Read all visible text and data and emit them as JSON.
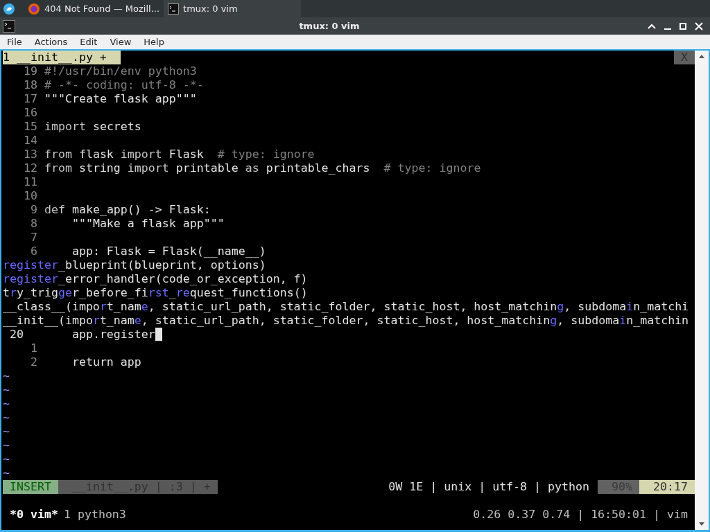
{
  "taskbar": {
    "tasks": [
      {
        "kind": "browser",
        "title": "404 Not Found — Mozill...",
        "selected": false
      },
      {
        "kind": "terminal",
        "title": "tmux: 0 vim",
        "selected": true
      }
    ]
  },
  "window": {
    "title": "tmux: 0 vim"
  },
  "menu": [
    "File",
    "Actions",
    "Edit",
    "View",
    "Help"
  ],
  "vim": {
    "tabs": [
      {
        "label": "1 __init__.py +",
        "selected": true
      }
    ],
    "close_label": "X",
    "lines": [
      {
        "kind": "code",
        "number": "19",
        "current": false,
        "cursor": false,
        "segments": [
          {
            "t": "#!/usr/bin/env python3",
            "kind": "comment"
          }
        ]
      },
      {
        "kind": "code",
        "number": "18",
        "current": false,
        "cursor": false,
        "segments": [
          {
            "t": "# -*- coding: utf-8 -*-",
            "kind": "comment"
          }
        ]
      },
      {
        "kind": "code",
        "number": "17",
        "current": false,
        "cursor": false,
        "segments": [
          {
            "t": "\"\"\"Create flask app\"\"\"",
            "kind": "plain"
          }
        ]
      },
      {
        "kind": "code",
        "number": "16",
        "current": false,
        "cursor": false
      },
      {
        "kind": "code",
        "number": "15",
        "current": false,
        "cursor": false,
        "segments": [
          {
            "t": "import",
            "kind": "keyword"
          },
          {
            "t": " secrets",
            "kind": "plain"
          }
        ]
      },
      {
        "kind": "code",
        "number": "14",
        "current": false,
        "cursor": false
      },
      {
        "kind": "code",
        "number": "13",
        "current": false,
        "cursor": false,
        "segments": [
          {
            "t": "from",
            "kind": "keyword"
          },
          {
            "t": " flask ",
            "kind": "plain"
          },
          {
            "t": "import",
            "kind": "keyword"
          },
          {
            "t": " Flask  ",
            "kind": "plain"
          },
          {
            "t": "# type: ignore",
            "kind": "comment"
          }
        ]
      },
      {
        "kind": "code",
        "number": "12",
        "current": false,
        "cursor": false,
        "segments": [
          {
            "t": "from",
            "kind": "keyword"
          },
          {
            "t": " string ",
            "kind": "plain"
          },
          {
            "t": "import",
            "kind": "keyword"
          },
          {
            "t": " printable ",
            "kind": "plain"
          },
          {
            "t": "as",
            "kind": "keyword"
          },
          {
            "t": " printable_chars  ",
            "kind": "plain"
          },
          {
            "t": "# type: ignore",
            "kind": "comment"
          }
        ]
      },
      {
        "kind": "code",
        "number": "11",
        "current": false,
        "cursor": false
      },
      {
        "kind": "code",
        "number": "10",
        "current": false,
        "cursor": false
      },
      {
        "kind": "code",
        "number": "9",
        "current": false,
        "cursor": false,
        "segments": [
          {
            "t": "def",
            "kind": "keyword"
          },
          {
            "t": " make_app() -> Flask:",
            "kind": "plain"
          }
        ]
      },
      {
        "kind": "code",
        "number": "8",
        "current": false,
        "cursor": false,
        "segments": [
          {
            "t": "    \"\"\"Make a flask app\"\"\"",
            "kind": "plain"
          }
        ]
      },
      {
        "kind": "code",
        "number": "7",
        "current": false,
        "cursor": false
      },
      {
        "kind": "code",
        "number": "6",
        "current": false,
        "cursor": false,
        "segments": [
          {
            "t": "    app: Flask = Flask(__name__)",
            "kind": "plain"
          }
        ]
      },
      {
        "kind": "completion",
        "segments": [
          {
            "t": "register",
            "kind": "match"
          },
          {
            "t": "_blueprint(blueprint, options)",
            "kind": "plain"
          }
        ]
      },
      {
        "kind": "completion",
        "segments": [
          {
            "t": "register",
            "kind": "match"
          },
          {
            "t": "_error_handler(code_or_exception, f)",
            "kind": "plain"
          }
        ]
      },
      {
        "kind": "completion",
        "segments": [
          {
            "t": "t",
            "kind": "plain"
          },
          {
            "t": "r",
            "kind": "match"
          },
          {
            "t": "y_trig",
            "kind": "plain"
          },
          {
            "t": "ge",
            "kind": "match"
          },
          {
            "t": "r_before_fi",
            "kind": "plain"
          },
          {
            "t": "rst",
            "kind": "match"
          },
          {
            "t": "_",
            "kind": "plain"
          },
          {
            "t": "re",
            "kind": "match"
          },
          {
            "t": "quest_functions()",
            "kind": "plain"
          }
        ]
      },
      {
        "kind": "completion",
        "segments": [
          {
            "t": "__class__(impo",
            "kind": "plain"
          },
          {
            "t": "r",
            "kind": "match"
          },
          {
            "t": "t_nam",
            "kind": "plain"
          },
          {
            "t": "e",
            "kind": "match"
          },
          {
            "t": ", static_url_path, static_folder, static_host, host_matchin",
            "kind": "plain"
          },
          {
            "t": "g",
            "kind": "match"
          },
          {
            "t": ", subdoma",
            "kind": "plain"
          },
          {
            "t": "i",
            "kind": "match"
          },
          {
            "t": "n_matchi",
            "kind": "plain"
          }
        ]
      },
      {
        "kind": "completion",
        "segments": [
          {
            "t": "__init__(impo",
            "kind": "plain"
          },
          {
            "t": "r",
            "kind": "match"
          },
          {
            "t": "t_nam",
            "kind": "plain"
          },
          {
            "t": "e",
            "kind": "match"
          },
          {
            "t": ", static_url_path, static_folder, static_host, host_matchin",
            "kind": "plain"
          },
          {
            "t": "g",
            "kind": "match"
          },
          {
            "t": ", subdoma",
            "kind": "plain"
          },
          {
            "t": "i",
            "kind": "match"
          },
          {
            "t": "n_matchin",
            "kind": "plain"
          }
        ]
      },
      {
        "kind": "code",
        "number": "20",
        "current": true,
        "cursor": true,
        "segments": [
          {
            "t": "    app.register",
            "kind": "plain"
          }
        ]
      },
      {
        "kind": "code",
        "number": "1",
        "current": false,
        "cursor": false
      },
      {
        "kind": "code",
        "number": "2",
        "current": false,
        "cursor": false,
        "segments": [
          {
            "t": "    return app",
            "kind": "plain"
          }
        ]
      },
      {
        "kind": "filler",
        "text": "~"
      },
      {
        "kind": "filler",
        "text": "~"
      },
      {
        "kind": "filler",
        "text": "~"
      },
      {
        "kind": "filler",
        "text": "~"
      },
      {
        "kind": "filler",
        "text": "~"
      },
      {
        "kind": "filler",
        "text": "~"
      },
      {
        "kind": "filler",
        "text": "~"
      },
      {
        "kind": "filler",
        "text": "~"
      }
    ],
    "status": {
      "mode": "INSERT",
      "file_info": "__init__.py | :3 | +",
      "info": "0W 1E | unix | utf-8 | python",
      "percent": "90%",
      "position": "20:17"
    }
  },
  "tmux": {
    "windows": [
      {
        "label": "*0 vim*",
        "selected": true
      },
      {
        "label": "1 python3",
        "selected": false
      }
    ],
    "right": "0.26 0.37 0.74 | 16:50:01 | vim"
  }
}
